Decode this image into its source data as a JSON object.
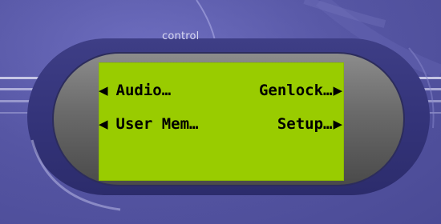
{
  "panel": {
    "brand_label": "control",
    "colors": {
      "background": "#5656a4",
      "lcd": "#99cc00",
      "lcd_text": "#000000"
    }
  },
  "lcd": {
    "rows": [
      {
        "left": {
          "label": "Audio…",
          "icon": "left-arrow-icon"
        },
        "right": {
          "label": "Genlock…",
          "icon": "right-arrow-icon"
        }
      },
      {
        "left": {
          "label": "User Mem…",
          "icon": "left-arrow-icon"
        },
        "right": {
          "label": "Setup…",
          "icon": "right-arrow-icon"
        }
      }
    ]
  }
}
